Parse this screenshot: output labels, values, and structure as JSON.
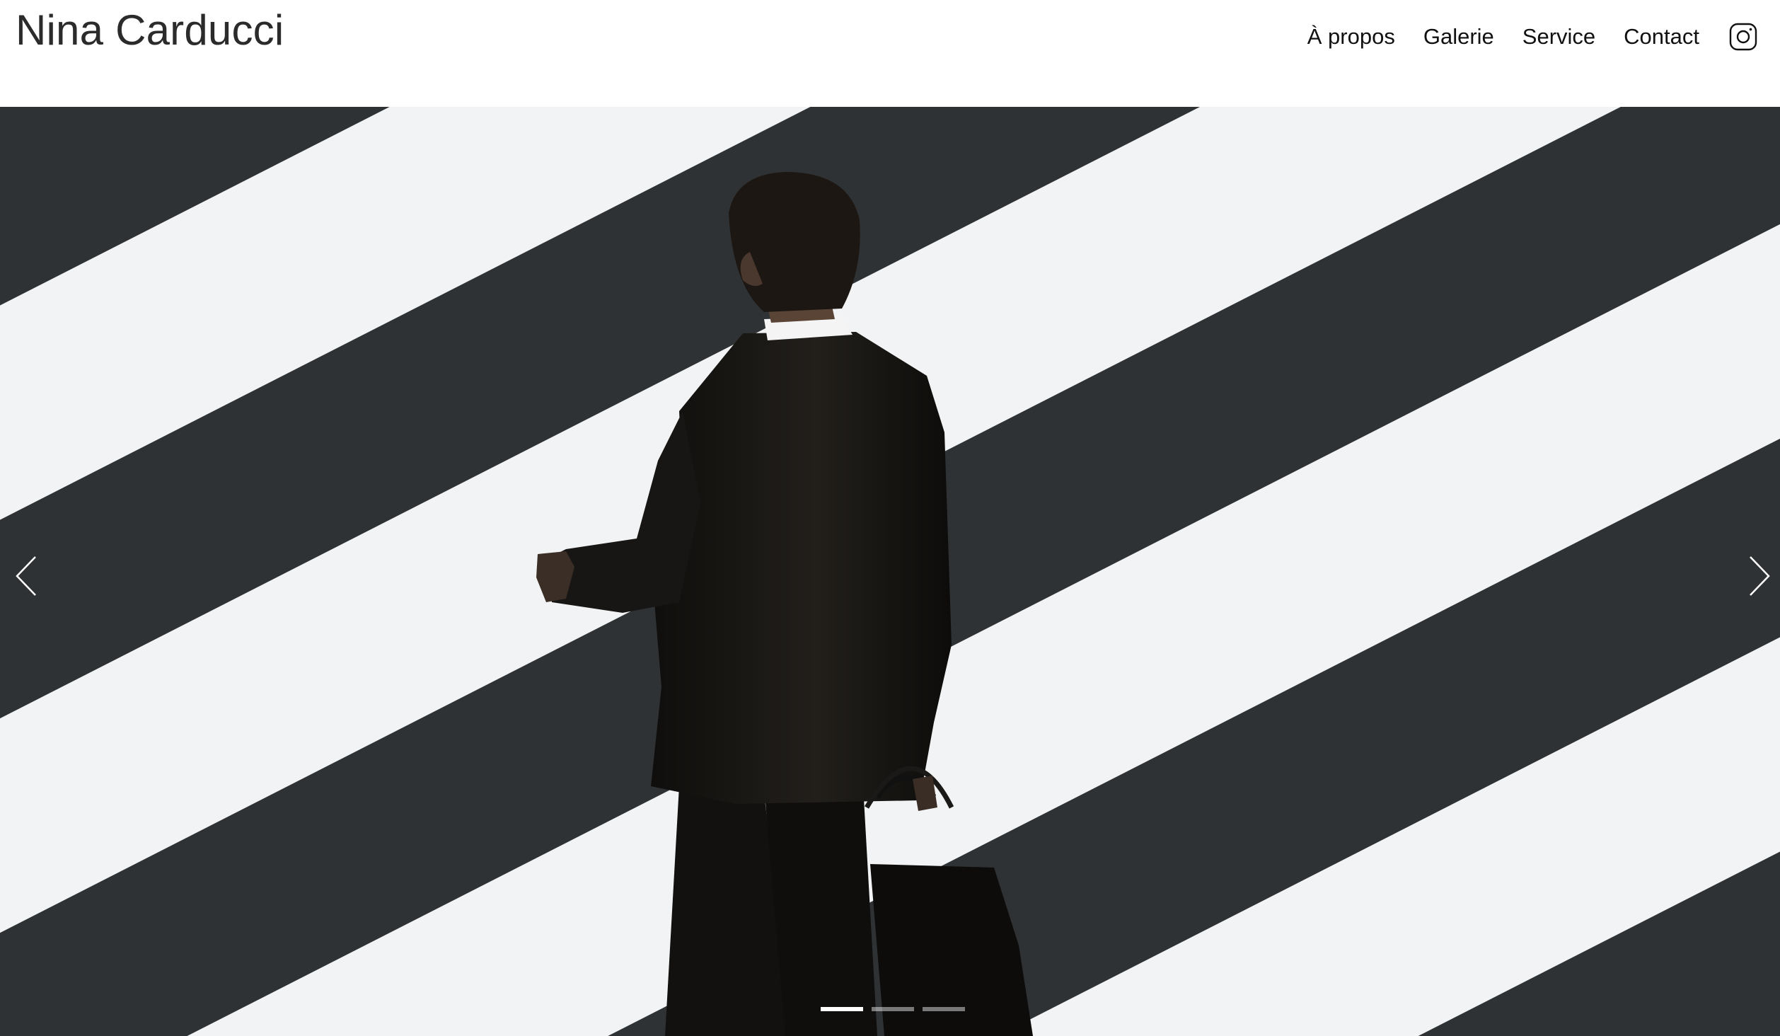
{
  "header": {
    "site_title": "Nina Carducci",
    "nav": [
      {
        "label": "À propos"
      },
      {
        "label": "Galerie"
      },
      {
        "label": "Service"
      },
      {
        "label": "Contact"
      }
    ],
    "social_icon": "instagram-icon"
  },
  "carousel": {
    "prev_icon": "chevron-left-icon",
    "next_icon": "chevron-right-icon",
    "slide_count": 3,
    "active_slide": 1
  },
  "colors": {
    "stripe_dark": "#2f3335",
    "stripe_light": "#f1f2f3",
    "suit": "#161412"
  }
}
